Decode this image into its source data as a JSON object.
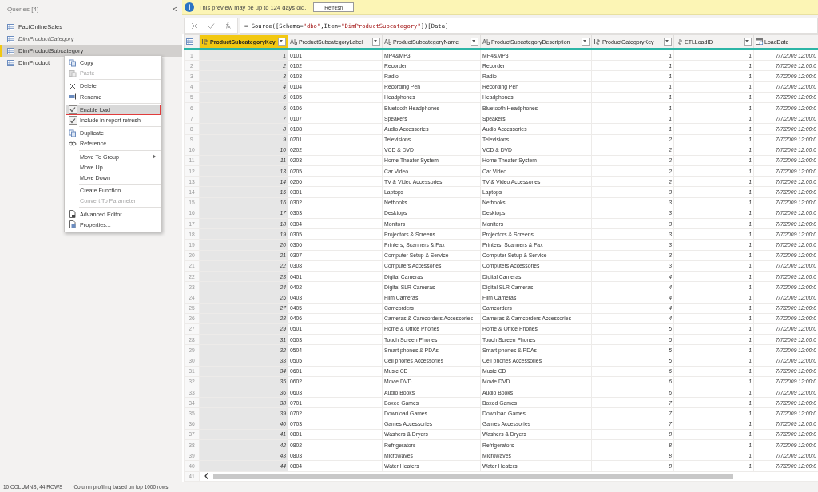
{
  "queries_panel": {
    "title": "Queries [4]",
    "collapse": "<",
    "items": [
      {
        "name": "FactOnlineSales",
        "selected": false,
        "load_enabled": true
      },
      {
        "name": "DimProductCategory",
        "selected": false,
        "load_enabled": false
      },
      {
        "name": "DimProductSubcategory",
        "selected": true,
        "load_enabled": true
      },
      {
        "name": "DimProduct",
        "selected": false,
        "load_enabled": true
      }
    ]
  },
  "context_menu": {
    "items": [
      {
        "kind": "item",
        "label": "Copy",
        "disabled": false
      },
      {
        "kind": "item",
        "label": "Paste",
        "disabled": true
      },
      {
        "kind": "separator"
      },
      {
        "kind": "item",
        "label": "Delete",
        "disabled": false
      },
      {
        "kind": "item",
        "label": "Rename",
        "disabled": false
      },
      {
        "kind": "separator"
      },
      {
        "kind": "check",
        "label": "Enable load",
        "checked": true,
        "selected": true
      },
      {
        "kind": "check",
        "label": "Include in report refresh",
        "checked": true,
        "selected": false
      },
      {
        "kind": "separator"
      },
      {
        "kind": "item",
        "label": "Duplicate",
        "disabled": false
      },
      {
        "kind": "item",
        "label": "Reference",
        "disabled": false
      },
      {
        "kind": "separator"
      },
      {
        "kind": "submenu",
        "label": "Move To Group"
      },
      {
        "kind": "item",
        "label": "Move Up",
        "disabled": false
      },
      {
        "kind": "item",
        "label": "Move Down",
        "disabled": false
      },
      {
        "kind": "separator"
      },
      {
        "kind": "item",
        "label": "Create Function...",
        "disabled": false
      },
      {
        "kind": "item",
        "label": "Convert To Parameter",
        "disabled": true
      },
      {
        "kind": "separator"
      },
      {
        "kind": "item",
        "label": "Advanced Editor",
        "disabled": false
      },
      {
        "kind": "item",
        "label": "Properties...",
        "disabled": false
      }
    ]
  },
  "banner": {
    "message": "This preview may be up to 124 days old.",
    "button": "Refresh"
  },
  "formula_bar": {
    "formula": "= Source([Schema=\"dbo\",Item=\"DimProductSubcategory\"])[Data]"
  },
  "table": {
    "columns": [
      {
        "kind": "row_number"
      },
      {
        "name": "ProductSubcategoryKey",
        "kind": "number",
        "selected": true
      },
      {
        "name": "ProductSubcategoryLabel",
        "kind": "text",
        "selected": false
      },
      {
        "name": "ProductSubcategoryName",
        "kind": "text",
        "selected": false
      },
      {
        "name": "ProductSubcategoryDescription",
        "kind": "text",
        "selected": false
      },
      {
        "name": "ProductCategoryKey",
        "kind": "number",
        "selected": false
      },
      {
        "name": "ETLLoadID",
        "kind": "number",
        "selected": false
      },
      {
        "name": "LoadDate",
        "kind": "datetime",
        "selected": false
      }
    ],
    "rows": [
      [
        "1",
        "1",
        "0101",
        "MP4&MP3",
        "MP4&MP3",
        "1",
        "1",
        "7/7/2009 12:00:0"
      ],
      [
        "2",
        "2",
        "0102",
        "Recorder",
        "Recorder",
        "1",
        "1",
        "7/7/2009 12:00:0"
      ],
      [
        "3",
        "3",
        "0103",
        "Radio",
        "Radio",
        "1",
        "1",
        "7/7/2009 12:00:0"
      ],
      [
        "4",
        "4",
        "0104",
        "Recording Pen",
        "Recording Pen",
        "1",
        "1",
        "7/7/2009 12:00:0"
      ],
      [
        "5",
        "5",
        "0105",
        "Headphones",
        "Headphones",
        "1",
        "1",
        "7/7/2009 12:00:0"
      ],
      [
        "6",
        "6",
        "0106",
        "Bluetooth Headphones",
        "Bluetooth Headphones",
        "1",
        "1",
        "7/7/2009 12:00:0"
      ],
      [
        "7",
        "7",
        "0107",
        "Speakers",
        "Speakers",
        "1",
        "1",
        "7/7/2009 12:00:0"
      ],
      [
        "8",
        "8",
        "0108",
        "Audio Accessories",
        "Audio Accessories",
        "1",
        "1",
        "7/7/2009 12:00:0"
      ],
      [
        "9",
        "9",
        "0201",
        "Televisions",
        "Televisions",
        "2",
        "1",
        "7/7/2009 12:00:0"
      ],
      [
        "10",
        "10",
        "0202",
        "VCD & DVD",
        "VCD & DVD",
        "2",
        "1",
        "7/7/2009 12:00:0"
      ],
      [
        "11",
        "11",
        "0203",
        "Home Theater System",
        "Home Theater System",
        "2",
        "1",
        "7/7/2009 12:00:0"
      ],
      [
        "12",
        "13",
        "0205",
        "Car Video",
        "Car Video",
        "2",
        "1",
        "7/7/2009 12:00:0"
      ],
      [
        "13",
        "14",
        "0206",
        "TV & Video Accessories",
        "TV & Video Accessories",
        "2",
        "1",
        "7/7/2009 12:00:0"
      ],
      [
        "14",
        "15",
        "0301",
        "Laptops",
        "Laptops",
        "3",
        "1",
        "7/7/2009 12:00:0"
      ],
      [
        "15",
        "16",
        "0302",
        "Netbooks",
        "Netbooks",
        "3",
        "1",
        "7/7/2009 12:00:0"
      ],
      [
        "16",
        "17",
        "0303",
        "Desktops",
        "Desktops",
        "3",
        "1",
        "7/7/2009 12:00:0"
      ],
      [
        "17",
        "18",
        "0304",
        "Monitors",
        "Monitors",
        "3",
        "1",
        "7/7/2009 12:00:0"
      ],
      [
        "18",
        "19",
        "0305",
        "Projectors & Screens",
        "Projectors & Screens",
        "3",
        "1",
        "7/7/2009 12:00:0"
      ],
      [
        "19",
        "20",
        "0306",
        "Printers, Scanners & Fax",
        "Printers, Scanners & Fax",
        "3",
        "1",
        "7/7/2009 12:00:0"
      ],
      [
        "20",
        "21",
        "0307",
        "Computer Setup & Service",
        "Computer Setup & Service",
        "3",
        "1",
        "7/7/2009 12:00:0"
      ],
      [
        "21",
        "22",
        "0308",
        "Computers Accessories",
        "Computers Accessories",
        "3",
        "1",
        "7/7/2009 12:00:0"
      ],
      [
        "22",
        "23",
        "0401",
        "Digital Cameras",
        "Digital Cameras",
        "4",
        "1",
        "7/7/2009 12:00:0"
      ],
      [
        "23",
        "24",
        "0402",
        "Digital SLR Cameras",
        "Digital SLR Cameras",
        "4",
        "1",
        "7/7/2009 12:00:0"
      ],
      [
        "24",
        "25",
        "0403",
        "Film Cameras",
        "Film Cameras",
        "4",
        "1",
        "7/7/2009 12:00:0"
      ],
      [
        "25",
        "27",
        "0405",
        "Camcorders",
        "Camcorders",
        "4",
        "1",
        "7/7/2009 12:00:0"
      ],
      [
        "26",
        "28",
        "0406",
        "Cameras & Camcorders Accessories",
        "Cameras & Camcorders Accessories",
        "4",
        "1",
        "7/7/2009 12:00:0"
      ],
      [
        "27",
        "29",
        "0501",
        "Home & Office Phones",
        "Home & Office Phones",
        "5",
        "1",
        "7/7/2009 12:00:0"
      ],
      [
        "28",
        "31",
        "0503",
        "Touch Screen Phones",
        "Touch Screen Phones",
        "5",
        "1",
        "7/7/2009 12:00:0"
      ],
      [
        "29",
        "32",
        "0504",
        "Smart phones & PDAs",
        "Smart phones & PDAs",
        "5",
        "1",
        "7/7/2009 12:00:0"
      ],
      [
        "30",
        "33",
        "0505",
        "Cell phones Accessories",
        "Cell phones Accessories",
        "5",
        "1",
        "7/7/2009 12:00:0"
      ],
      [
        "31",
        "34",
        "0601",
        "Music CD",
        "Music CD",
        "6",
        "1",
        "7/7/2009 12:00:0"
      ],
      [
        "32",
        "35",
        "0602",
        "Movie DVD",
        "Movie DVD",
        "6",
        "1",
        "7/7/2009 12:00:0"
      ],
      [
        "33",
        "36",
        "0603",
        "Audio Books",
        "Audio Books",
        "6",
        "1",
        "7/7/2009 12:00:0"
      ],
      [
        "34",
        "38",
        "0701",
        "Boxed Games",
        "Boxed Games",
        "7",
        "1",
        "7/7/2009 12:00:0"
      ],
      [
        "35",
        "39",
        "0702",
        "Download Games",
        "Download Games",
        "7",
        "1",
        "7/7/2009 12:00:0"
      ],
      [
        "36",
        "40",
        "0703",
        "Games Accessories",
        "Games Accessories",
        "7",
        "1",
        "7/7/2009 12:00:0"
      ],
      [
        "37",
        "41",
        "0801",
        "Washers & Dryers",
        "Washers & Dryers",
        "8",
        "1",
        "7/7/2009 12:00:0"
      ],
      [
        "38",
        "42",
        "0802",
        "Refrigerators",
        "Refrigerators",
        "8",
        "1",
        "7/7/2009 12:00:0"
      ],
      [
        "39",
        "43",
        "0803",
        "Microwaves",
        "Microwaves",
        "8",
        "1",
        "7/7/2009 12:00:0"
      ],
      [
        "40",
        "44",
        "0804",
        "Water Heaters",
        "Water Heaters",
        "8",
        "1",
        "7/7/2009 12:00:0"
      ]
    ],
    "last_row_number": "41"
  },
  "status_bar": {
    "counts": "10 COLUMNS, 44 ROWS",
    "profiling": "Column profiling based on top 1000 rows"
  }
}
